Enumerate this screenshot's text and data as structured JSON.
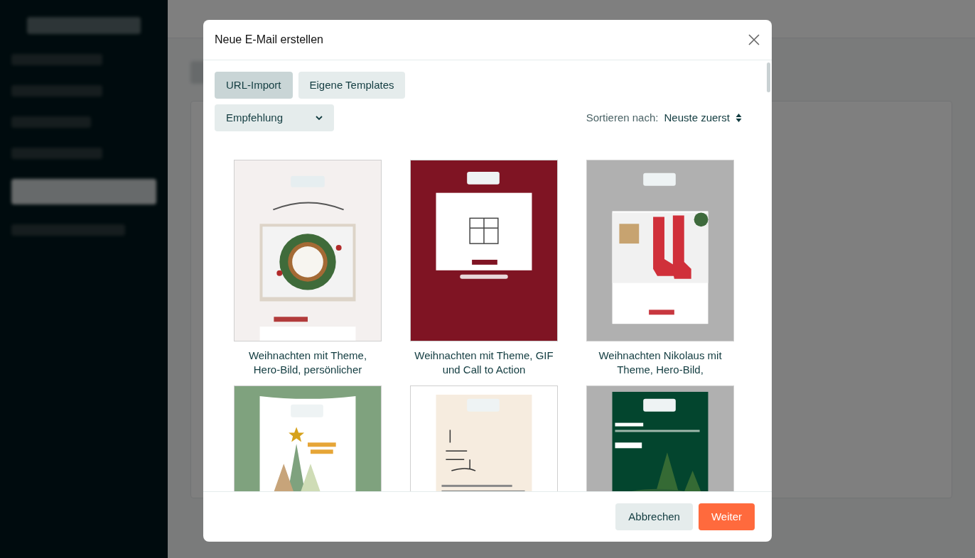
{
  "dialog": {
    "title": "Neue E-Mail erstellen",
    "tabs": [
      {
        "label": "URL-Import",
        "selected": true
      },
      {
        "label": "Eigene Templates",
        "selected": false
      }
    ],
    "filter": {
      "value": "Empfehlung"
    },
    "sort": {
      "label": "Sortieren nach:",
      "value": "Neuste zuerst"
    },
    "templates": [
      {
        "title": "Weihnachten mit Theme, Hero-Bild, persönlicher",
        "preview": {
          "kind": "picture"
        }
      },
      {
        "title": "Weihnachten mit Theme, GIF und Call to Action",
        "preview": {
          "kind": "picture"
        }
      },
      {
        "title": "Weihnachten Nikolaus mit Theme, Hero-Bild,",
        "preview": {
          "kind": "picture"
        }
      },
      {
        "preview": {
          "kind": "picture"
        }
      },
      {
        "preview": {
          "kind": "picture"
        }
      },
      {
        "preview": {
          "kind": "picture"
        }
      }
    ],
    "buttons": [
      {
        "label": "Abbrechen",
        "kind": "secondary"
      },
      {
        "label": "Weiter",
        "kind": "primary"
      }
    ]
  }
}
